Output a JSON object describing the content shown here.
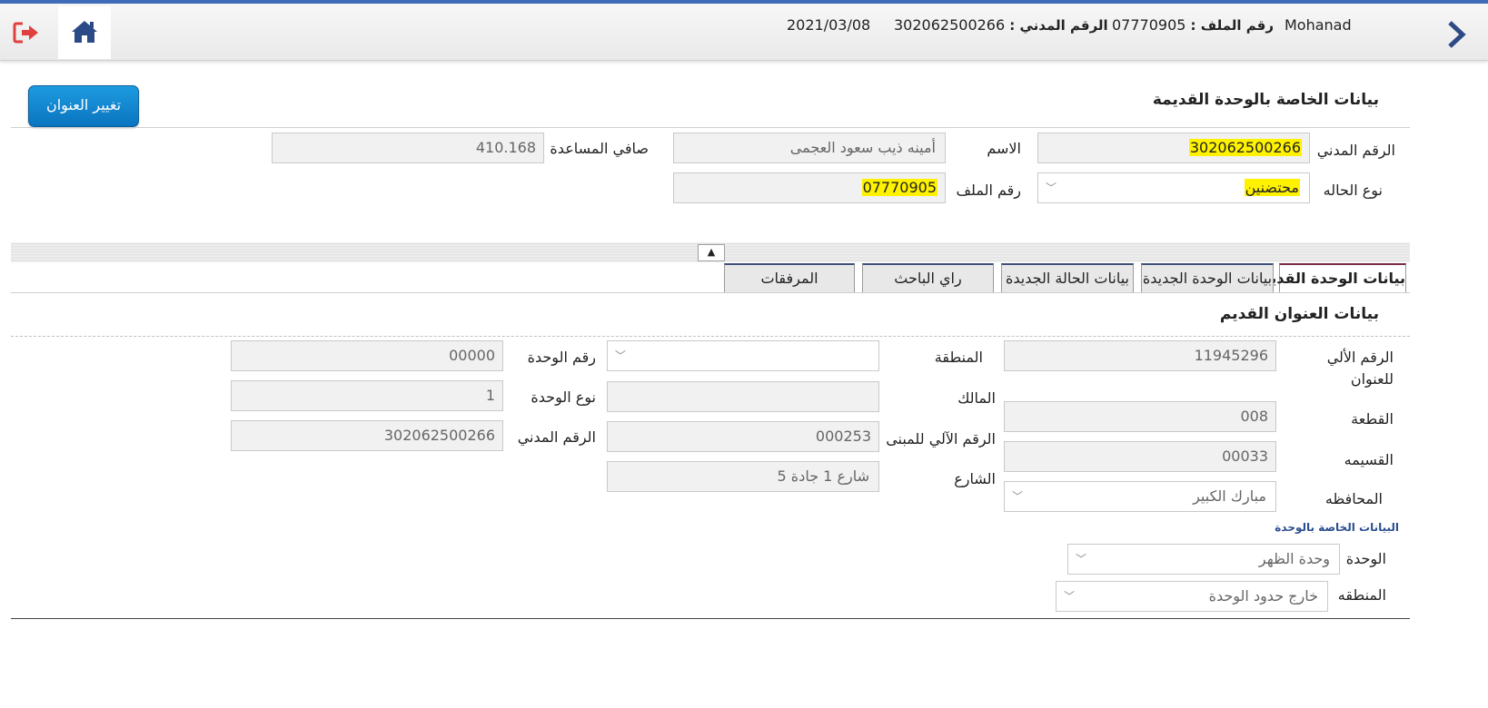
{
  "header": {
    "user": "Mohanad",
    "file_label": "رقم الملف :",
    "file_value": "07770905",
    "civil_label": "الرقم المدني :",
    "civil_value": "302062500266",
    "date": "2021/03/08"
  },
  "actions": {
    "change_address": "تغيير العنوان"
  },
  "old_unit": {
    "title": "بيانات الخاصة بالوحدة القديمة",
    "civil_id_label": "الرقم المدني",
    "civil_id_value": "302062500266",
    "name_label": "الاسم",
    "name_value": "أمينه ذيب سعود العجمى",
    "net_aid_label": "صافي المساعدة",
    "net_aid_value": "410.168",
    "case_type_label": "نوع الحاله",
    "case_type_value": "محتضنين",
    "file_no_label": "رقم الملف",
    "file_no_value": "07770905"
  },
  "tabs": [
    {
      "label": "بيانات الوحدة القديمة"
    },
    {
      "label": "بيانات الوحدة الجديدة"
    },
    {
      "label": "بيانات الحالة الجديدة"
    },
    {
      "label": "راي الباحث"
    },
    {
      "label": "المرفقات"
    }
  ],
  "toggle": {
    "symbol": "▲"
  },
  "old_address": {
    "title": "بيانات العنوان القديم",
    "auto_addr_label": "الرقم الألي للعنوان",
    "auto_addr_value": "11945296",
    "plot_label": "القطعة",
    "plot_value": "008",
    "parcel_label": "القسيمه",
    "parcel_value": "00033",
    "governorate_label": "المحافظه",
    "governorate_value": "مبارك الكبير",
    "area_label": "المنطقة",
    "area_value": "",
    "owner_label": "المالك",
    "owner_value": "",
    "building_label": "الرقم الآلي للمبنى",
    "building_value": "000253",
    "street_label": "الشارع",
    "street_value": "شارع 1 جادة 5",
    "unit_no_label": "رقم الوحدة",
    "unit_no_value": "00000",
    "unit_type_label": "نوع الوحدة",
    "unit_type_value": "1",
    "civil_label": "الرقم المدني",
    "civil_value": "302062500266"
  },
  "unit_data": {
    "heading": "البيانات الخاصة بالوحدة",
    "unit_label": "الوحدة",
    "unit_value": "وحدة الظهر",
    "zone_label": "المنطقه",
    "zone_value": "خارج حدود الوحدة"
  },
  "colors": {
    "accent": "#0a74bf",
    "highlight": "#fff200",
    "top_bar": "#3f6bb8"
  }
}
